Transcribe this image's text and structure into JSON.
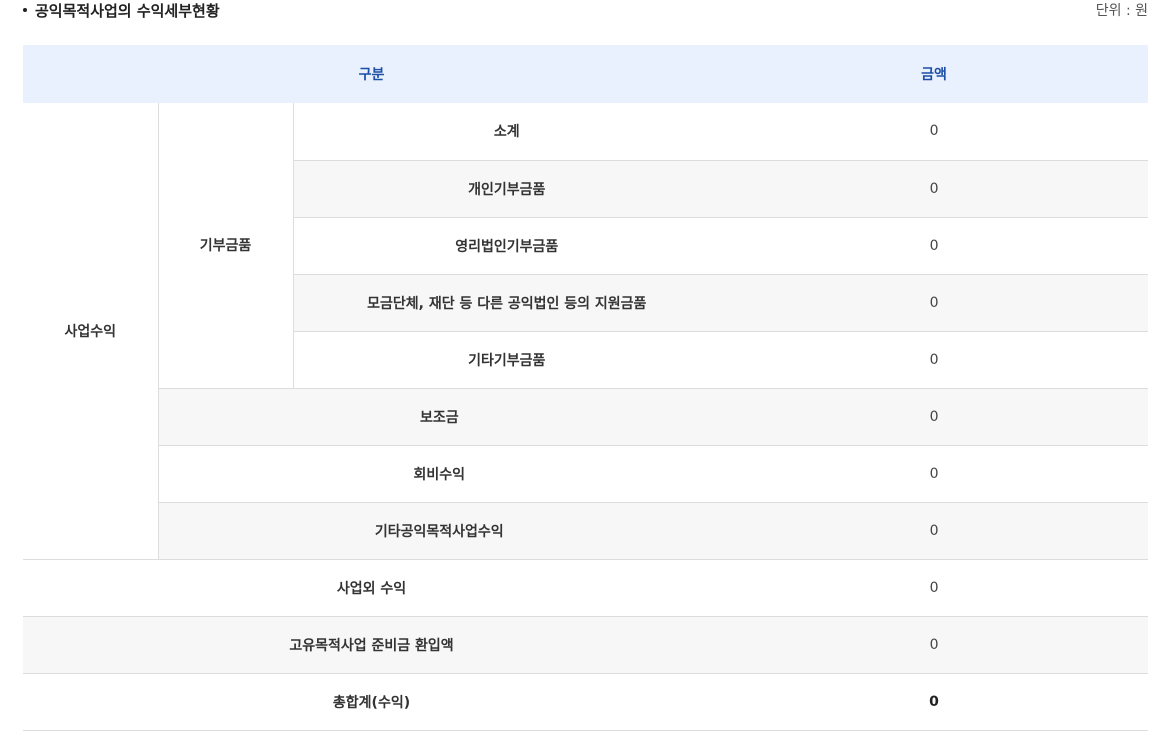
{
  "section": {
    "title": "공익목적사업의 수익세부현황",
    "unit": "단위 : 원"
  },
  "table": {
    "headers": {
      "category": "구분",
      "amount": "금액"
    },
    "groups": {
      "business_revenue": "사업수익",
      "donations": "기부금품"
    },
    "rows": [
      {
        "label": "소계",
        "amount": "0"
      },
      {
        "label": "개인기부금품",
        "amount": "0"
      },
      {
        "label": "영리법인기부금품",
        "amount": "0"
      },
      {
        "label": "모금단체, 재단 등 다른 공익법인 등의 지원금품",
        "amount": "0"
      },
      {
        "label": "기타기부금품",
        "amount": "0"
      },
      {
        "label": "보조금",
        "amount": "0"
      },
      {
        "label": "회비수익",
        "amount": "0"
      },
      {
        "label": "기타공익목적사업수익",
        "amount": "0"
      },
      {
        "label": "사업외 수익",
        "amount": "0"
      },
      {
        "label": "고유목적사업 준비금 환입액",
        "amount": "0"
      },
      {
        "label": "총합계(수익)",
        "amount": "0"
      }
    ]
  },
  "colors": {
    "header_background": "#e8f1fd",
    "header_text": "#1d4fa8",
    "stripe_background": "#f7f7f7",
    "border": "#dddddd"
  }
}
